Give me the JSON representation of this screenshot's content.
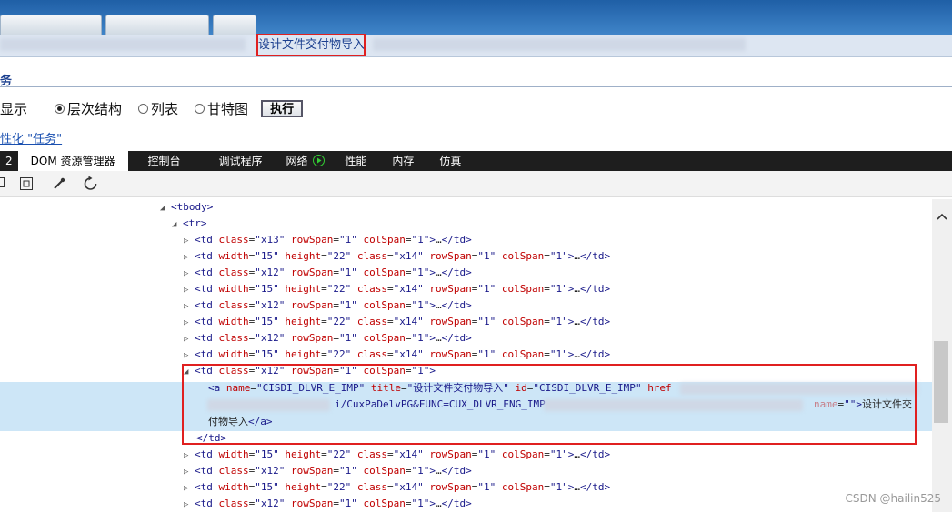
{
  "nav": {
    "highlighted_link": "设计文件交付物导入"
  },
  "section": {
    "title": "务"
  },
  "view": {
    "label": "显示",
    "options": [
      {
        "label": "层次结构",
        "selected": true
      },
      {
        "label": "列表",
        "selected": false
      },
      {
        "label": "甘特图",
        "selected": false
      }
    ],
    "execute_label": "执行",
    "personalize_link": "性化 \"任务\""
  },
  "devtools": {
    "tabs": [
      {
        "label": "2"
      },
      {
        "label": "DOM 资源管理器",
        "active": true
      },
      {
        "label": "控制台"
      },
      {
        "label": "调试程序"
      },
      {
        "label": "网络"
      },
      {
        "label": "性能"
      },
      {
        "label": "内存"
      },
      {
        "label": "仿真"
      }
    ]
  },
  "dom": {
    "tbody": "<tbody>",
    "tr": "<tr>",
    "rows": [
      {
        "attrs": [
          [
            "class",
            "x13"
          ],
          [
            "rowSpan",
            "1"
          ],
          [
            "colSpan",
            "1"
          ]
        ]
      },
      {
        "attrs": [
          [
            "width",
            "15"
          ],
          [
            "height",
            "22"
          ],
          [
            "class",
            "x14"
          ],
          [
            "rowSpan",
            "1"
          ],
          [
            "colSpan",
            "1"
          ]
        ]
      },
      {
        "attrs": [
          [
            "class",
            "x12"
          ],
          [
            "rowSpan",
            "1"
          ],
          [
            "colSpan",
            "1"
          ]
        ]
      },
      {
        "attrs": [
          [
            "width",
            "15"
          ],
          [
            "height",
            "22"
          ],
          [
            "class",
            "x14"
          ],
          [
            "rowSpan",
            "1"
          ],
          [
            "colSpan",
            "1"
          ]
        ]
      },
      {
        "attrs": [
          [
            "class",
            "x12"
          ],
          [
            "rowSpan",
            "1"
          ],
          [
            "colSpan",
            "1"
          ]
        ]
      },
      {
        "attrs": [
          [
            "width",
            "15"
          ],
          [
            "height",
            "22"
          ],
          [
            "class",
            "x14"
          ],
          [
            "rowSpan",
            "1"
          ],
          [
            "colSpan",
            "1"
          ]
        ]
      },
      {
        "attrs": [
          [
            "class",
            "x12"
          ],
          [
            "rowSpan",
            "1"
          ],
          [
            "colSpan",
            "1"
          ]
        ]
      },
      {
        "attrs": [
          [
            "width",
            "15"
          ],
          [
            "height",
            "22"
          ],
          [
            "class",
            "x14"
          ],
          [
            "rowSpan",
            "1"
          ],
          [
            "colSpan",
            "1"
          ]
        ]
      }
    ],
    "open_td": {
      "attrs": [
        [
          "class",
          "x12"
        ],
        [
          "rowSpan",
          "1"
        ],
        [
          "colSpan",
          "1"
        ]
      ]
    },
    "anchor": {
      "name": "CISDI_DLVR_E_IMP",
      "title": "设计文件交付物导入",
      "id": "CISDI_DLVR_E_IMP",
      "href_label": "href",
      "href_part": "i/CuxPaDelvPG&FUNC=CUX_DLVR_ENG_IMP",
      "tail_attr": "name",
      "tail_value": "\"\"",
      "text_part1": "设计文件交",
      "text_part2": "付物导入"
    },
    "close_td": "</td>",
    "rows_after": [
      {
        "attrs": [
          [
            "width",
            "15"
          ],
          [
            "height",
            "22"
          ],
          [
            "class",
            "x14"
          ],
          [
            "rowSpan",
            "1"
          ],
          [
            "colSpan",
            "1"
          ]
        ]
      },
      {
        "attrs": [
          [
            "class",
            "x12"
          ],
          [
            "rowSpan",
            "1"
          ],
          [
            "colSpan",
            "1"
          ]
        ]
      },
      {
        "attrs": [
          [
            "width",
            "15"
          ],
          [
            "height",
            "22"
          ],
          [
            "class",
            "x14"
          ],
          [
            "rowSpan",
            "1"
          ],
          [
            "colSpan",
            "1"
          ]
        ]
      },
      {
        "attrs": [
          [
            "class",
            "x12"
          ],
          [
            "rowSpan",
            "1"
          ],
          [
            "colSpan",
            "1"
          ]
        ]
      }
    ]
  },
  "watermark": "CSDN @hailin525"
}
